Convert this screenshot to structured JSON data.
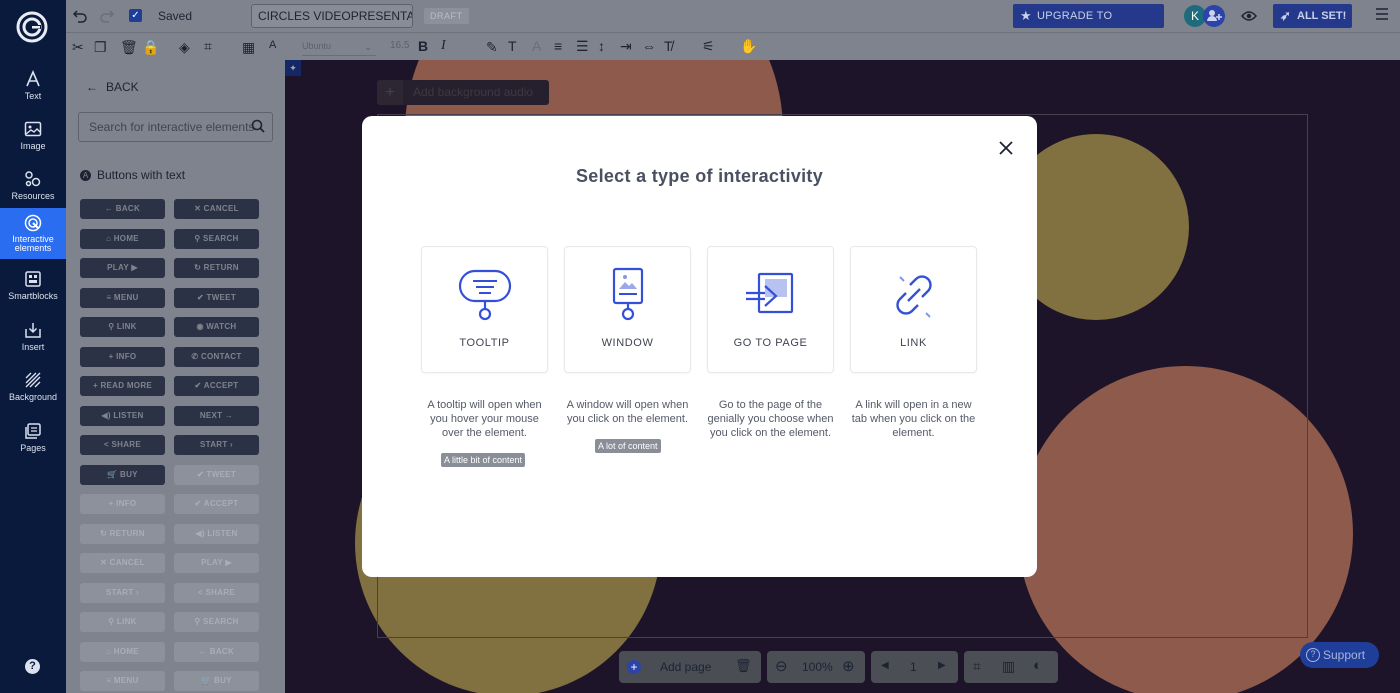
{
  "app": {
    "saved_label": "Saved",
    "project_title": "CIRCLES VIDEOPRESENTATION",
    "draft_label": "DRAFT",
    "upgrade_label": "UPGRADE TO PREMIUM",
    "all_set_label": "ALL SET!",
    "avatar_initial": "K"
  },
  "text_toolbar": {
    "font": "Ubuntu",
    "font_size": "16.5"
  },
  "rail": {
    "items": [
      {
        "label": "Text"
      },
      {
        "label": "Image"
      },
      {
        "label": "Resources"
      },
      {
        "label": "Interactive elements"
      },
      {
        "label": "Smartblocks"
      },
      {
        "label": "Insert"
      },
      {
        "label": "Background"
      },
      {
        "label": "Pages"
      }
    ],
    "help": "?"
  },
  "panel": {
    "back_label": "BACK",
    "search_placeholder": "Search for interactive elements",
    "section_label": "Buttons with text",
    "section_badge": "A",
    "buttons_left": [
      {
        "label": "← BACK",
        "style": "dark"
      },
      {
        "label": "⌂ HOME",
        "style": "dark"
      },
      {
        "label": "PLAY ▶",
        "style": "dark"
      },
      {
        "label": "≡ MENU",
        "style": "dark"
      },
      {
        "label": "⚲ LINK",
        "style": "dark"
      },
      {
        "label": "+ INFO",
        "style": "dark"
      },
      {
        "label": "+ READ MORE",
        "style": "dark"
      },
      {
        "label": "◀) LISTEN",
        "style": "dark"
      },
      {
        "label": "< SHARE",
        "style": "dark"
      },
      {
        "label": "🛒 BUY",
        "style": "dark"
      },
      {
        "label": "+ INFO",
        "style": "light"
      },
      {
        "label": "↻ RETURN",
        "style": "light"
      },
      {
        "label": "✕ CANCEL",
        "style": "light"
      },
      {
        "label": "START ›",
        "style": "light"
      },
      {
        "label": "⚲ LINK",
        "style": "light"
      },
      {
        "label": "⌂ HOME",
        "style": "light"
      },
      {
        "label": "≡ MENU",
        "style": "light"
      }
    ],
    "buttons_right": [
      {
        "label": "✕ CANCEL",
        "style": "dark"
      },
      {
        "label": "⚲ SEARCH",
        "style": "dark"
      },
      {
        "label": "↻ RETURN",
        "style": "dark"
      },
      {
        "label": "✔ TWEET",
        "style": "dark"
      },
      {
        "label": "◉ WATCH",
        "style": "dark"
      },
      {
        "label": "✆ CONTACT",
        "style": "dark"
      },
      {
        "label": "✔ ACCEPT",
        "style": "dark"
      },
      {
        "label": "NEXT →",
        "style": "dark"
      },
      {
        "label": "START ›",
        "style": "dark"
      },
      {
        "label": "✔ TWEET",
        "style": "light"
      },
      {
        "label": "✔ ACCEPT",
        "style": "light"
      },
      {
        "label": "◀) LISTEN",
        "style": "light"
      },
      {
        "label": "PLAY ▶",
        "style": "light"
      },
      {
        "label": "< SHARE",
        "style": "light"
      },
      {
        "label": "⚲ SEARCH",
        "style": "light"
      },
      {
        "label": "← BACK",
        "style": "light"
      },
      {
        "label": "🛒 BUY",
        "style": "light"
      }
    ]
  },
  "canvas": {
    "add_audio_label": "Add background audio",
    "colors": {
      "background": "#2d1f3f",
      "salmon": "#d98a74",
      "olive": "#c6ad63"
    }
  },
  "bottom": {
    "add_page_label": "Add page",
    "zoom": "100%",
    "page_number": "1",
    "support_label": "Support"
  },
  "modal": {
    "title": "Select a type of interactivity",
    "accent_color": "#3550d8",
    "options": [
      {
        "label": "TOOLTIP",
        "icon": "speech-bubble-icon",
        "description": "A tooltip will open when you hover your mouse over the element.",
        "tag": "A little bit of content"
      },
      {
        "label": "WINDOW",
        "icon": "window-icon",
        "description": "A window will open when you click on the element.",
        "tag": "A lot of content"
      },
      {
        "label": "GO TO PAGE",
        "icon": "go-to-page-icon",
        "description": "Go to the page of the genially you choose when you click on the element.",
        "tag": ""
      },
      {
        "label": "LINK",
        "icon": "link-icon",
        "description": "A link will open in a new tab when you click on the element.",
        "tag": ""
      }
    ]
  }
}
